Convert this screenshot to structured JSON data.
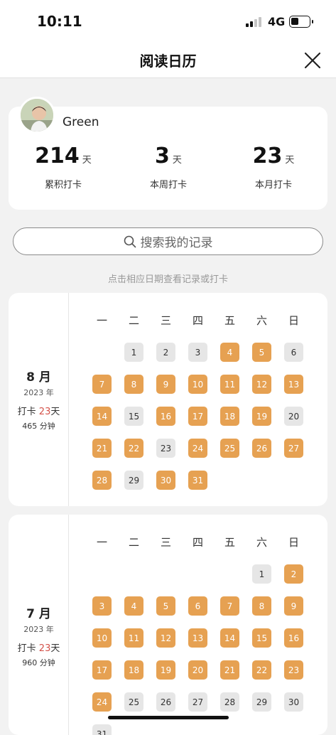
{
  "status_bar": {
    "time": "10:11",
    "network": "4G"
  },
  "nav": {
    "title": "阅读日历"
  },
  "profile": {
    "username": "Green"
  },
  "stats": [
    {
      "value": "214",
      "unit": "天",
      "label": "累积打卡"
    },
    {
      "value": "3",
      "unit": "天",
      "label": "本周打卡"
    },
    {
      "value": "23",
      "unit": "天",
      "label": "本月打卡"
    }
  ],
  "search": {
    "placeholder": "搜索我的记录"
  },
  "hint": "点击相应日期查看记录或打卡",
  "weekday_labels": [
    "一",
    "二",
    "三",
    "四",
    "五",
    "六",
    "日"
  ],
  "colors": {
    "active_day": "#e6a152",
    "inactive_day": "#e6e6e6",
    "highlight_text": "#d4524a"
  },
  "months": [
    {
      "name": "8 月",
      "year": "2023 年",
      "punch_prefix": "打卡",
      "punch_count": "23",
      "punch_unit": "天",
      "minutes": "465 分钟",
      "first_weekday": 1,
      "days": [
        {
          "d": "1",
          "on": false
        },
        {
          "d": "2",
          "on": false
        },
        {
          "d": "3",
          "on": false
        },
        {
          "d": "4",
          "on": true
        },
        {
          "d": "5",
          "on": true
        },
        {
          "d": "6",
          "on": false
        },
        {
          "d": "7",
          "on": true
        },
        {
          "d": "8",
          "on": true
        },
        {
          "d": "9",
          "on": true
        },
        {
          "d": "10",
          "on": true
        },
        {
          "d": "11",
          "on": true
        },
        {
          "d": "12",
          "on": true
        },
        {
          "d": "13",
          "on": true
        },
        {
          "d": "14",
          "on": true
        },
        {
          "d": "15",
          "on": false
        },
        {
          "d": "16",
          "on": true
        },
        {
          "d": "17",
          "on": true
        },
        {
          "d": "18",
          "on": true
        },
        {
          "d": "19",
          "on": true
        },
        {
          "d": "20",
          "on": false
        },
        {
          "d": "21",
          "on": true
        },
        {
          "d": "22",
          "on": true
        },
        {
          "d": "23",
          "on": false
        },
        {
          "d": "24",
          "on": true
        },
        {
          "d": "25",
          "on": true
        },
        {
          "d": "26",
          "on": true
        },
        {
          "d": "27",
          "on": true
        },
        {
          "d": "28",
          "on": true
        },
        {
          "d": "29",
          "on": false
        },
        {
          "d": "30",
          "on": true
        },
        {
          "d": "31",
          "on": true
        }
      ]
    },
    {
      "name": "7 月",
      "year": "2023 年",
      "punch_prefix": "打卡",
      "punch_count": "23",
      "punch_unit": "天",
      "minutes": "960 分钟",
      "first_weekday": 5,
      "days": [
        {
          "d": "1",
          "on": false
        },
        {
          "d": "2",
          "on": true
        },
        {
          "d": "3",
          "on": true
        },
        {
          "d": "4",
          "on": true
        },
        {
          "d": "5",
          "on": true
        },
        {
          "d": "6",
          "on": true
        },
        {
          "d": "7",
          "on": true
        },
        {
          "d": "8",
          "on": true
        },
        {
          "d": "9",
          "on": true
        },
        {
          "d": "10",
          "on": true
        },
        {
          "d": "11",
          "on": true
        },
        {
          "d": "12",
          "on": true
        },
        {
          "d": "13",
          "on": true
        },
        {
          "d": "14",
          "on": true
        },
        {
          "d": "15",
          "on": true
        },
        {
          "d": "16",
          "on": true
        },
        {
          "d": "17",
          "on": true
        },
        {
          "d": "18",
          "on": true
        },
        {
          "d": "19",
          "on": true
        },
        {
          "d": "20",
          "on": true
        },
        {
          "d": "21",
          "on": true
        },
        {
          "d": "22",
          "on": true
        },
        {
          "d": "23",
          "on": true
        },
        {
          "d": "24",
          "on": true
        },
        {
          "d": "25",
          "on": false
        },
        {
          "d": "26",
          "on": false
        },
        {
          "d": "27",
          "on": false
        },
        {
          "d": "28",
          "on": false
        },
        {
          "d": "29",
          "on": false
        },
        {
          "d": "30",
          "on": false
        },
        {
          "d": "31",
          "on": false
        }
      ]
    }
  ]
}
